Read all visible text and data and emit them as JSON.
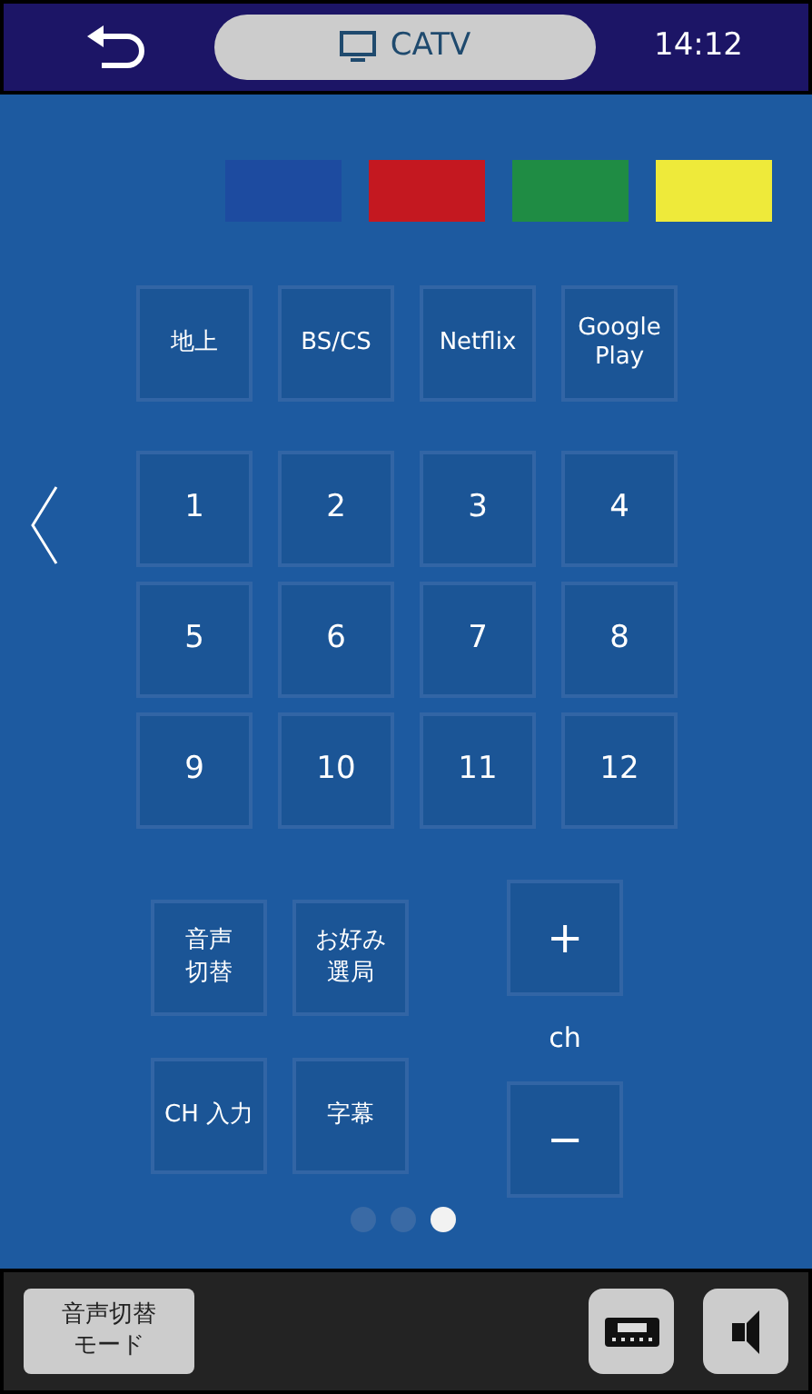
{
  "header": {
    "source": "CATV",
    "time": "14:12"
  },
  "color_keys": [
    {
      "color": "#1d4ba0"
    },
    {
      "color": "#c41820"
    },
    {
      "color": "#1f8c44"
    },
    {
      "color": "#eeea3a"
    }
  ],
  "broadcast_buttons": [
    "地上",
    "BS/CS",
    "Netflix",
    "Google Play"
  ],
  "number_buttons": [
    "1",
    "2",
    "3",
    "4",
    "5",
    "6",
    "7",
    "8",
    "9",
    "10",
    "11",
    "12"
  ],
  "function_buttons": [
    [
      "音声",
      "切替"
    ],
    [
      "お好み",
      "選局"
    ],
    [
      "CH 入力"
    ],
    [
      "字幕"
    ]
  ],
  "channel": {
    "up": "+",
    "label": "ch",
    "down": "−"
  },
  "page_dots": [
    {
      "selected": false
    },
    {
      "selected": false
    },
    {
      "selected": true
    }
  ],
  "footer": {
    "mode_button": [
      "音声切替",
      "モード"
    ]
  }
}
